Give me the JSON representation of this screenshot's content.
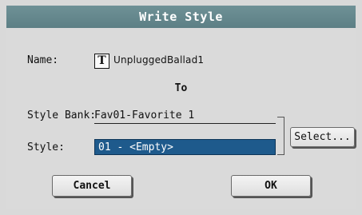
{
  "dialog": {
    "title": "Write Style"
  },
  "name": {
    "label": "Name:",
    "icon": "text-icon",
    "icon_glyph": "T",
    "value": "UnpluggedBallad1"
  },
  "to_label": "To",
  "style_bank": {
    "label": "Style Bank:",
    "value": "Fav01-Favorite 1"
  },
  "style": {
    "label": "Style:",
    "value": "01 - <Empty>"
  },
  "buttons": {
    "select": "Select...",
    "cancel": "Cancel",
    "ok": "OK"
  },
  "colors": {
    "title_bar": "#5c7f85",
    "selected_field": "#1e5a8c",
    "background": "#d9d9d9"
  }
}
